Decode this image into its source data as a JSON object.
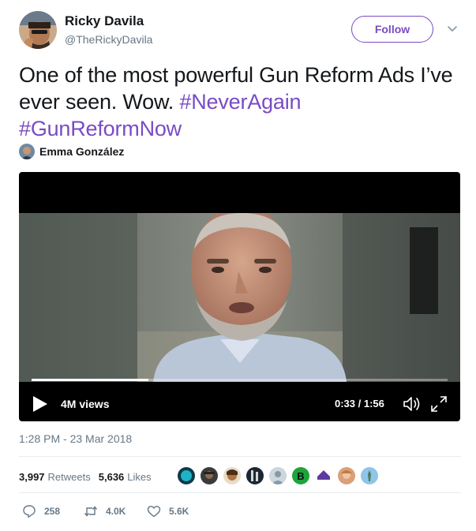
{
  "author": {
    "name": "Ricky Davila",
    "handle": "@TheRickyDavila",
    "follow_label": "Follow"
  },
  "tweet": {
    "text": "One of the most powerful Gun Reform Ads I’ve ever seen. Wow.",
    "hashtags": [
      "#NeverAgain",
      "#GunReformNow"
    ]
  },
  "video": {
    "attribution_name": "Emma González",
    "views": "4M views",
    "time": "0:33 / 1:56",
    "progress": 0.28
  },
  "timestamp": "1:28 PM - 23 Mar 2018",
  "stats": {
    "retweets_count": "3,997",
    "retweets_label": "Retweets",
    "likes_count": "5,636",
    "likes_label": "Likes"
  },
  "actions": {
    "replies": "258",
    "retweets": "4.0K",
    "likes": "5.6K"
  },
  "colors": {
    "accent": "#794bc4",
    "muted": "#657786",
    "text": "#14171a"
  },
  "icons": {
    "caret": "chevron-down-icon",
    "play": "play-icon",
    "volume": "volume-icon",
    "expand": "expand-icon",
    "reply": "reply-icon",
    "retweet": "retweet-icon",
    "like": "heart-icon"
  }
}
